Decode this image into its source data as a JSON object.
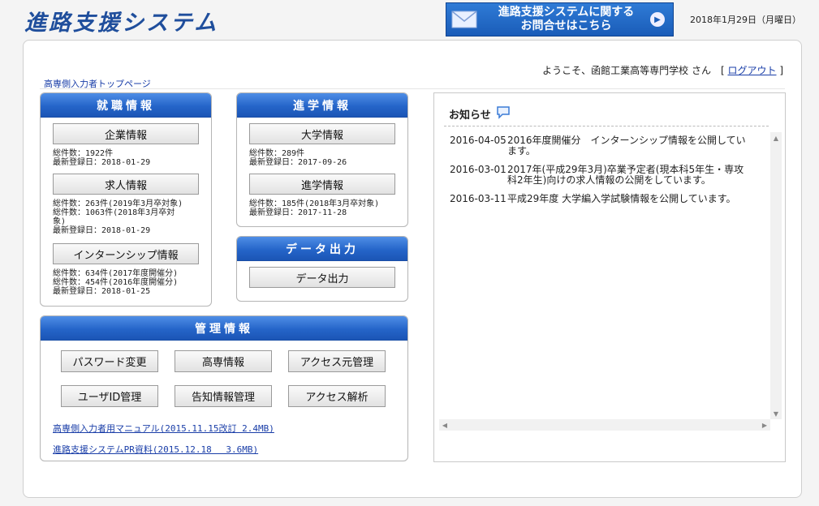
{
  "header": {
    "logo": "進路支援システム",
    "banner_line1": "進路支援システムに関する",
    "banner_line2": "お問合せはこちら",
    "date": "2018年1月29日（月曜日）"
  },
  "welcome": {
    "prefix": "ようこそ、函館工業高等専門学校 さん　[ ",
    "logout": "ログアウト",
    "suffix": " ]"
  },
  "breadcrumb": "高専側入力者トップページ",
  "shushoku": {
    "title": "就職情報",
    "company_btn": "企業情報",
    "company_stat": "総件数：1922件\n最新登録日：2018-01-29",
    "job_btn": "求人情報",
    "job_stat": "総件数：263件(2019年3月卒対象)\n総件数：1063件(2018年3月卒対\n象)\n最新登録日：2018-01-29",
    "intern_btn": "インターンシップ情報",
    "intern_stat": "総件数：634件(2017年度開催分)\n総件数：454件(2016年度開催分)\n最新登録日：2018-01-25"
  },
  "shingaku": {
    "title": "進学情報",
    "univ_btn": "大学情報",
    "univ_stat": "総件数：289件\n最新登録日：2017-09-26",
    "adv_btn": "進学情報",
    "adv_stat": "総件数：185件(2018年3月卒対象)\n最新登録日：2017-11-28"
  },
  "data_out": {
    "title": "データ出力",
    "btn": "データ出力"
  },
  "kanri": {
    "title": "管理情報",
    "buttons": [
      "パスワード変更",
      "高専情報",
      "アクセス元管理",
      "ユーザID管理",
      "告知情報管理",
      "アクセス解析"
    ],
    "manual_link": "高専側入力者用マニュアル(2015.11.15改訂 2.4MB)",
    "pr_link": "進路支援システムPR資料(2015.12.18　 3.6MB)"
  },
  "news": {
    "title": "お知らせ",
    "items": [
      {
        "date": "2016-04-05",
        "text": "2016年度開催分　インターンシップ情報を公開しています。"
      },
      {
        "date": "2016-03-01",
        "text": "2017年(平成29年3月)卒業予定者(現本科5年生・専攻科2年生)向けの求人情報の公開をしています。"
      },
      {
        "date": "2016-03-11",
        "text": "平成29年度 大学編入学試験情報を公開しています。"
      }
    ]
  },
  "icons": {
    "banner": "envelope-icon",
    "news": "speech-bubble-icon"
  }
}
